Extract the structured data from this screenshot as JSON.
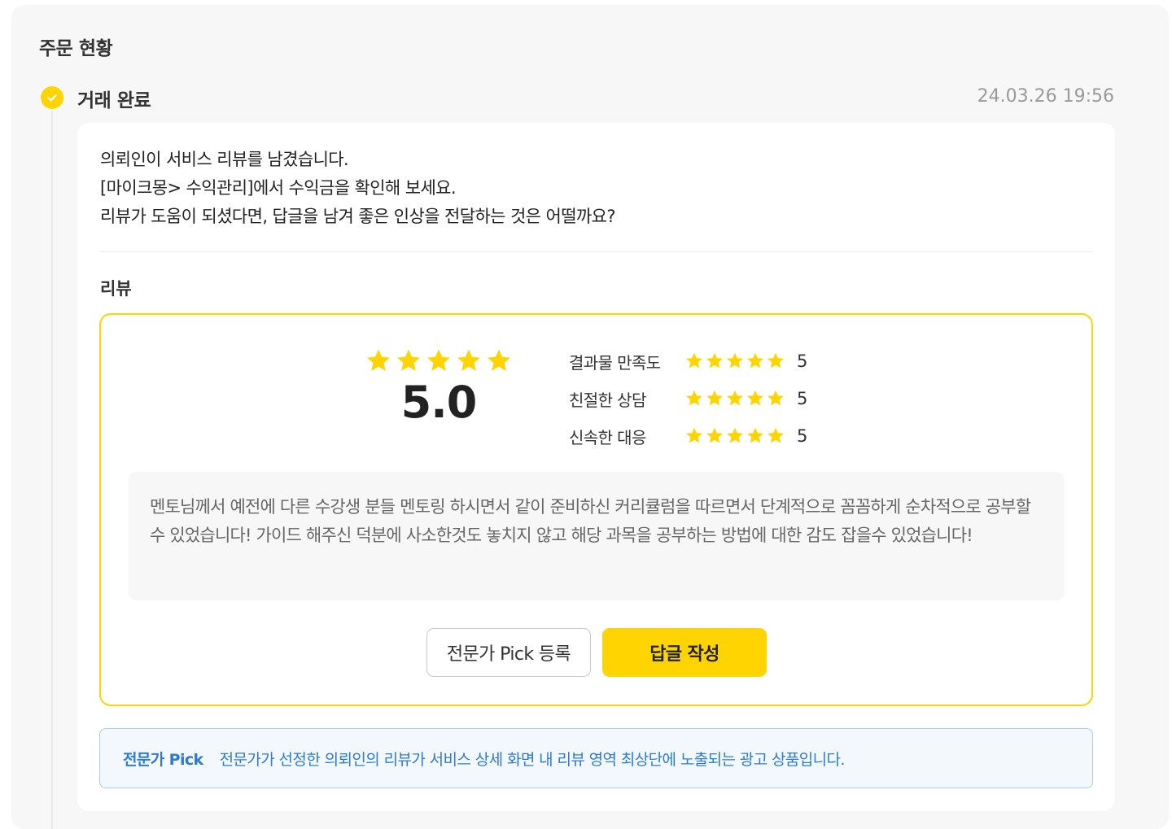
{
  "section": {
    "title": "주문 현황"
  },
  "status": {
    "label": "거래 완료",
    "time": "24.03.26 19:56",
    "icon": "check-circle-icon",
    "color": "#ffd400"
  },
  "message": {
    "lines": [
      "의뢰인이 서비스 리뷰를 남겼습니다.",
      "[마이크몽> 수익관리]에서 수익금을 확인해 보세요.",
      "리뷰가 도움이 되셨다면, 답글을 남겨 좋은 인상을 전달하는 것은 어떨까요?"
    ]
  },
  "review": {
    "title": "리뷰",
    "overall_score": "5.0",
    "overall_stars": 5,
    "criteria": [
      {
        "label": "결과물 만족도",
        "stars": 5,
        "score": "5"
      },
      {
        "label": "친절한 상담",
        "stars": 5,
        "score": "5"
      },
      {
        "label": "신속한 대응",
        "stars": 5,
        "score": "5"
      }
    ],
    "text": "멘토님께서 예전에 다른 수강생 분들 멘토링 하시면서 같이 준비하신 커리큘럼을 따르면서 단계적으로 꼼꼼하게 순차적으로 공부할수 있었습니다!  가이드 해주신 덕분에 사소한것도 놓치지 않고 해당 과목을 공부하는 방법에 대한 감도 잡을수 있었습니다!",
    "pick_button": "전문가 Pick 등록",
    "reply_button": "답글 작성"
  },
  "info": {
    "tag": "전문가 Pick",
    "text": "전문가가 선정한 의뢰인의 리뷰가 서비스 상세 화면 내 리뷰 영역 최상단에 노출되는 광고 상품입니다."
  },
  "colors": {
    "accent": "#ffd400",
    "info_blue": "#2f7bd0",
    "star": "#ffd400"
  }
}
